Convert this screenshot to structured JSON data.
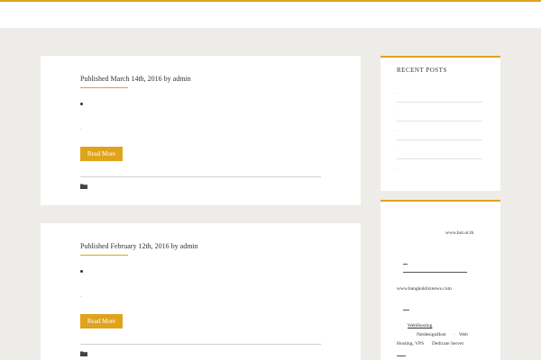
{
  "posts": [
    {
      "meta": "Published March 14th, 2016 by admin",
      "read_more": "Read More",
      "bullet_dot": "."
    },
    {
      "meta": "Published February 12th, 2016 by admin",
      "read_more": "Read More",
      "bullet_dot": "."
    }
  ],
  "sidebar": {
    "recent_posts": {
      "title": "RECENT POSTS",
      "items": [
        ".",
        ".",
        ".",
        ".",
        "."
      ]
    },
    "links_widget": {
      "site1": "www.bot.or.th",
      "site2": "www.bangkokbiznews.com",
      "web_hosting": "WebHosting",
      "netdesign": "NetdesignHost",
      "web": "Web",
      "hosting_line": "Hosting, VPS",
      "dedicate": "Dedicate Server"
    }
  },
  "colors": {
    "accent": "#e0a31c",
    "background": "#eeece8"
  },
  "icons": {
    "category": "folder-icon"
  }
}
